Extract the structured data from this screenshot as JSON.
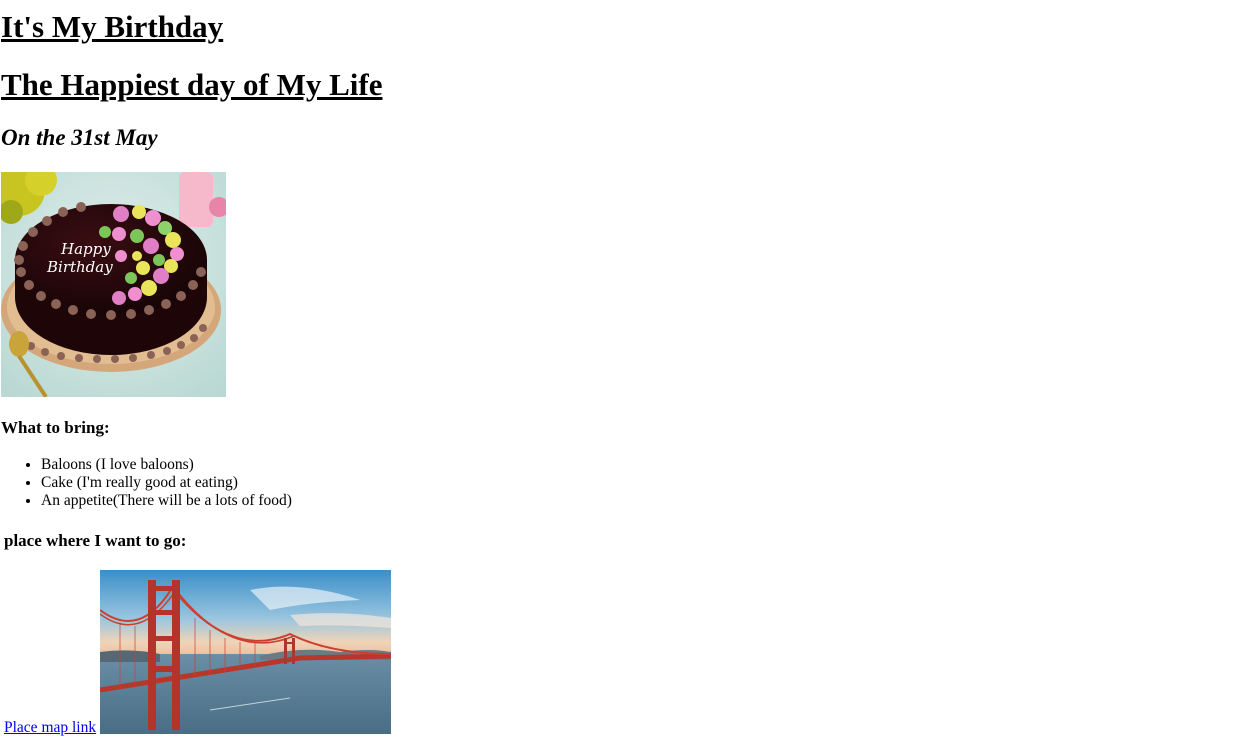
{
  "title_1": "It's My Birthday",
  "title_2": "The Happiest day of My Life",
  "subtitle": "On the 31st May",
  "cake_image": {
    "icon": "birthday-cake-photo",
    "text_line_1": "Happy",
    "text_line_2": "Birthday"
  },
  "bring": {
    "heading": "What to bring:",
    "items": [
      "Baloons (I love baloons)",
      "Cake (I'm really good at eating)",
      "An appetite(There will be a lots of food)"
    ]
  },
  "place": {
    "heading": "place where I want to go:",
    "link_text": "Place map link",
    "image_icon": "golden-gate-bridge-photo"
  }
}
